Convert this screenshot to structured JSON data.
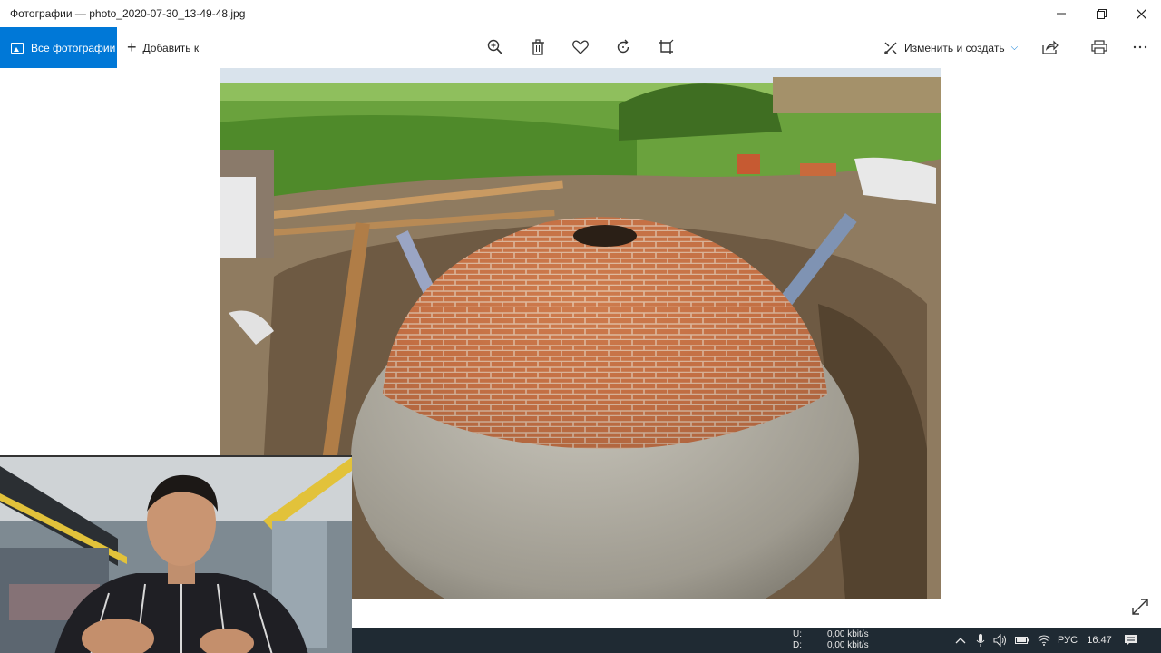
{
  "window": {
    "title": "Фотографии — photo_2020-07-30_13-49-48.jpg",
    "minimize_icon": "minimize-icon",
    "maximize_icon": "restore-icon",
    "close_icon": "close-icon"
  },
  "toolbar": {
    "all_photos_label": "Все фотографии",
    "add_to_label": "Добавить к",
    "zoom_icon": "zoom-icon",
    "delete_icon": "trash-icon",
    "favorite_icon": "heart-icon",
    "rotate_icon": "rotate-icon",
    "crop_icon": "crop-icon",
    "edit_create_label": "Изменить и создать",
    "share_icon": "share-icon",
    "print_icon": "print-icon",
    "more_icon": "more-icon"
  },
  "colors": {
    "accent": "#0078d7",
    "taskbar": "#1f2a33"
  },
  "taskbar": {
    "upload_label": "U:",
    "upload_value": "0,00 kbit/s",
    "download_label": "D:",
    "download_value": "0,00 kbit/s",
    "language": "РУС",
    "time": "16:47"
  }
}
